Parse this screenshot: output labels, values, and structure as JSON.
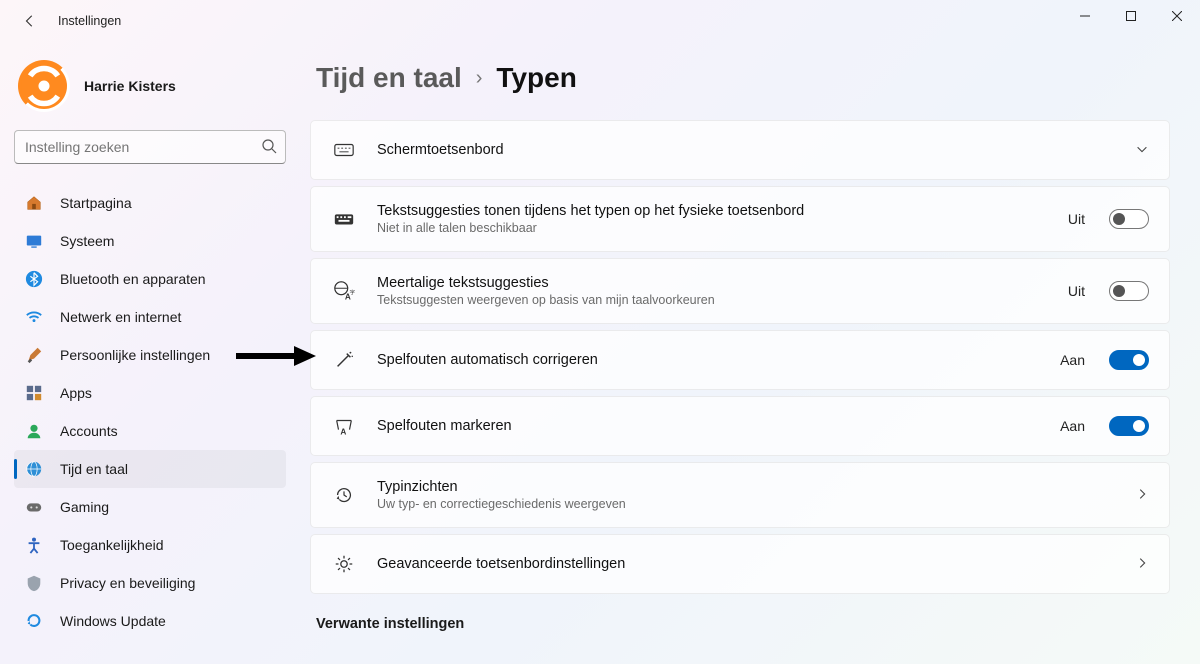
{
  "window": {
    "title": "Instellingen"
  },
  "user": {
    "name": "Harrie Kisters"
  },
  "search": {
    "placeholder": "Instelling zoeken"
  },
  "sidebar": {
    "items": [
      {
        "id": "home",
        "label": "Startpagina"
      },
      {
        "id": "system",
        "label": "Systeem"
      },
      {
        "id": "bluetooth",
        "label": "Bluetooth en apparaten"
      },
      {
        "id": "network",
        "label": "Netwerk en internet"
      },
      {
        "id": "personalization",
        "label": "Persoonlijke instellingen"
      },
      {
        "id": "apps",
        "label": "Apps"
      },
      {
        "id": "accounts",
        "label": "Accounts"
      },
      {
        "id": "time",
        "label": "Tijd en taal",
        "active": true
      },
      {
        "id": "gaming",
        "label": "Gaming"
      },
      {
        "id": "accessibility",
        "label": "Toegankelijkheid"
      },
      {
        "id": "privacy",
        "label": "Privacy en beveiliging"
      },
      {
        "id": "update",
        "label": "Windows Update"
      }
    ]
  },
  "breadcrumb": {
    "parent": "Tijd en taal",
    "current": "Typen"
  },
  "cards": {
    "touchKeyboard": {
      "title": "Schermtoetsenbord"
    },
    "textSuggestions": {
      "title": "Tekstsuggesties tonen tijdens het typen op het fysieke toetsenbord",
      "sub": "Niet in alle talen beschikbaar",
      "state": "Uit"
    },
    "multilingual": {
      "title": "Meertalige tekstsuggesties",
      "sub": "Tekstsuggesten weergeven op basis van mijn taalvoorkeuren",
      "state": "Uit"
    },
    "autocorrect": {
      "title": "Spelfouten automatisch corrigeren",
      "state": "Aan"
    },
    "highlight": {
      "title": "Spelfouten markeren",
      "state": "Aan"
    },
    "insights": {
      "title": "Typinzichten",
      "sub": "Uw typ- en correctiegeschiedenis weergeven"
    },
    "advanced": {
      "title": "Geavanceerde toetsenbordinstellingen"
    }
  },
  "sections": {
    "related": "Verwante instellingen"
  }
}
